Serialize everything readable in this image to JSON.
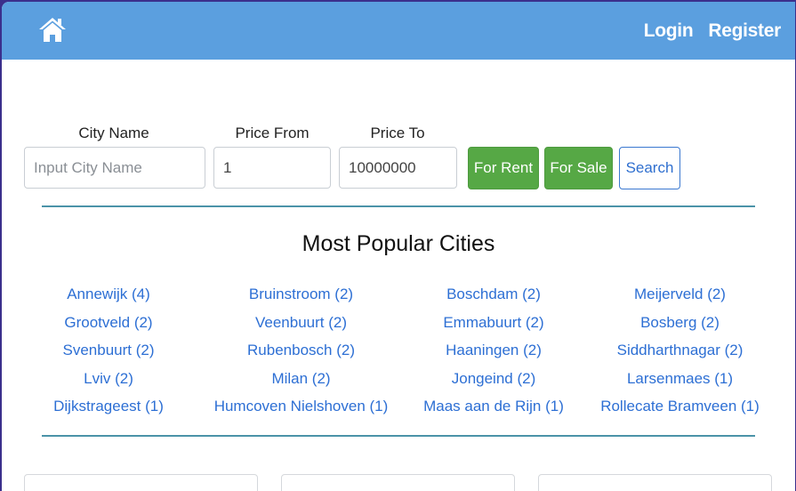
{
  "navbar": {
    "home_icon": "home-icon",
    "login_label": "Login",
    "register_label": "Register",
    "background": "#5b9fdf"
  },
  "search": {
    "city_label": "City Name",
    "city_placeholder": "Input City Name",
    "city_value": "",
    "price_from_label": "Price From",
    "price_from_value": "1",
    "price_to_label": "Price To",
    "price_to_value": "10000000",
    "for_rent_label": "For Rent",
    "for_sale_label": "For Sale",
    "search_label": "Search",
    "button_green": "#56a845",
    "button_outline": "#2f6fcf"
  },
  "popular": {
    "title": "Most Popular Cities",
    "cities": [
      "Annewijk (4)",
      "Bruinstroom (2)",
      "Boschdam (2)",
      "Meijerveld (2)",
      "Grootveld (2)",
      "Veenbuurt (2)",
      "Emmabuurt (2)",
      "Bosberg (2)",
      "Svenbuurt (2)",
      "Rubenbosch (2)",
      "Haaningen (2)",
      "Siddharthnagar (2)",
      "Lviv (2)",
      "Milan (2)",
      "Jongeind (2)",
      "Larsenmaes (1)",
      "Dijkstrageest (1)",
      "Humcoven Nielshoven (1)",
      "Maas aan de Rijn (1)",
      "Rollecate Bramveen (1)"
    ],
    "link_color": "#2d6fd4",
    "divider_color": "#4b93a8"
  }
}
